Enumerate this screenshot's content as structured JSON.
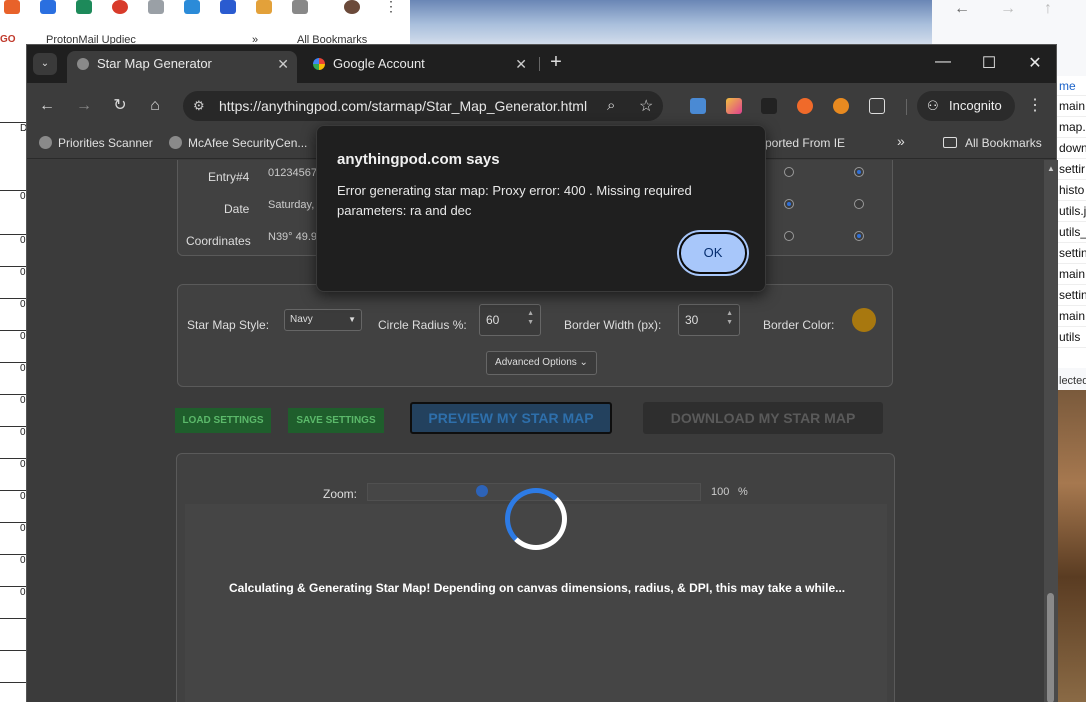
{
  "taskbar_icons": [
    "app-icon-m",
    "app-icon-pin",
    "app-icon-shield",
    "app-icon-g",
    "app-icon-bug",
    "app-icon-bracket",
    "app-icon-s",
    "app-icon-orange",
    "app-icon-puzzle",
    "avatar",
    "more-icon"
  ],
  "background_bookmarks": {
    "prefix": "GO",
    "item1": "ProtonMail Updiec",
    "chevron": "»",
    "item2": "All Bookmarks"
  },
  "right_file_list": [
    "me",
    "main",
    "map.",
    "down",
    "settir",
    "histo",
    "utils.j",
    "utils_",
    "settin",
    "main",
    "settin",
    "main",
    "utils"
  ],
  "right_selected_text": "lected",
  "left_sheet_labels": [
    "D",
    "0",
    "0",
    "0",
    "0",
    "0",
    "0",
    "0",
    "0",
    "0",
    "0",
    "0",
    "0",
    "0"
  ],
  "tabs": [
    {
      "title": "Star Map Generator",
      "close": "✕"
    },
    {
      "title": "Google Account",
      "close": "✕"
    }
  ],
  "new_tab": "+",
  "window_controls": {
    "minimize": "—",
    "maximize": "☐",
    "close": "✕"
  },
  "omnibox": {
    "url": "https://anythingpod.com/starmap/Star_Map_Generator.html"
  },
  "incognito_label": "Incognito",
  "bookmarks": {
    "item1": "Priorities Scanner",
    "item2": "McAfee SecurityCen...",
    "item3": "ported From IE",
    "overflow": "»",
    "all": "All Bookmarks"
  },
  "form": {
    "entry4_label": "Entry#4",
    "entry4_value": "01234567",
    "date_label": "Date",
    "date_value": "Saturday,",
    "coords_label": "Coordinates",
    "coords_value": "N39° 49.9'",
    "style_label": "Star Map Style:",
    "style_value": "Navy",
    "radius_label": "Circle Radius %:",
    "radius_value": "60",
    "border_width_label": "Border Width (px):",
    "border_width_value": "30",
    "border_color_label": "Border Color:",
    "border_color": "#a8780f",
    "advanced_label": "Advanced Options ⌄"
  },
  "buttons": {
    "load": "LOAD SETTINGS",
    "save": "SAVE SETTINGS",
    "preview": "PREVIEW MY STAR MAP",
    "download": "DOWNLOAD MY STAR MAP"
  },
  "zoom": {
    "label": "Zoom:",
    "value": "100",
    "unit": "%"
  },
  "loading_text": "Calculating & Generating Star Map! Depending on canvas dimensions, radius, & DPI, this may take a while...",
  "dialog": {
    "title": "anythingpod.com says",
    "message": "Error generating star map: Proxy error: 400 . Missing required parameters: ra and dec",
    "ok": "OK"
  },
  "colors": {
    "accent": "#a8c7fa",
    "chrome_dark": "#1f1f1f",
    "page_bg": "#3b3b3b"
  }
}
